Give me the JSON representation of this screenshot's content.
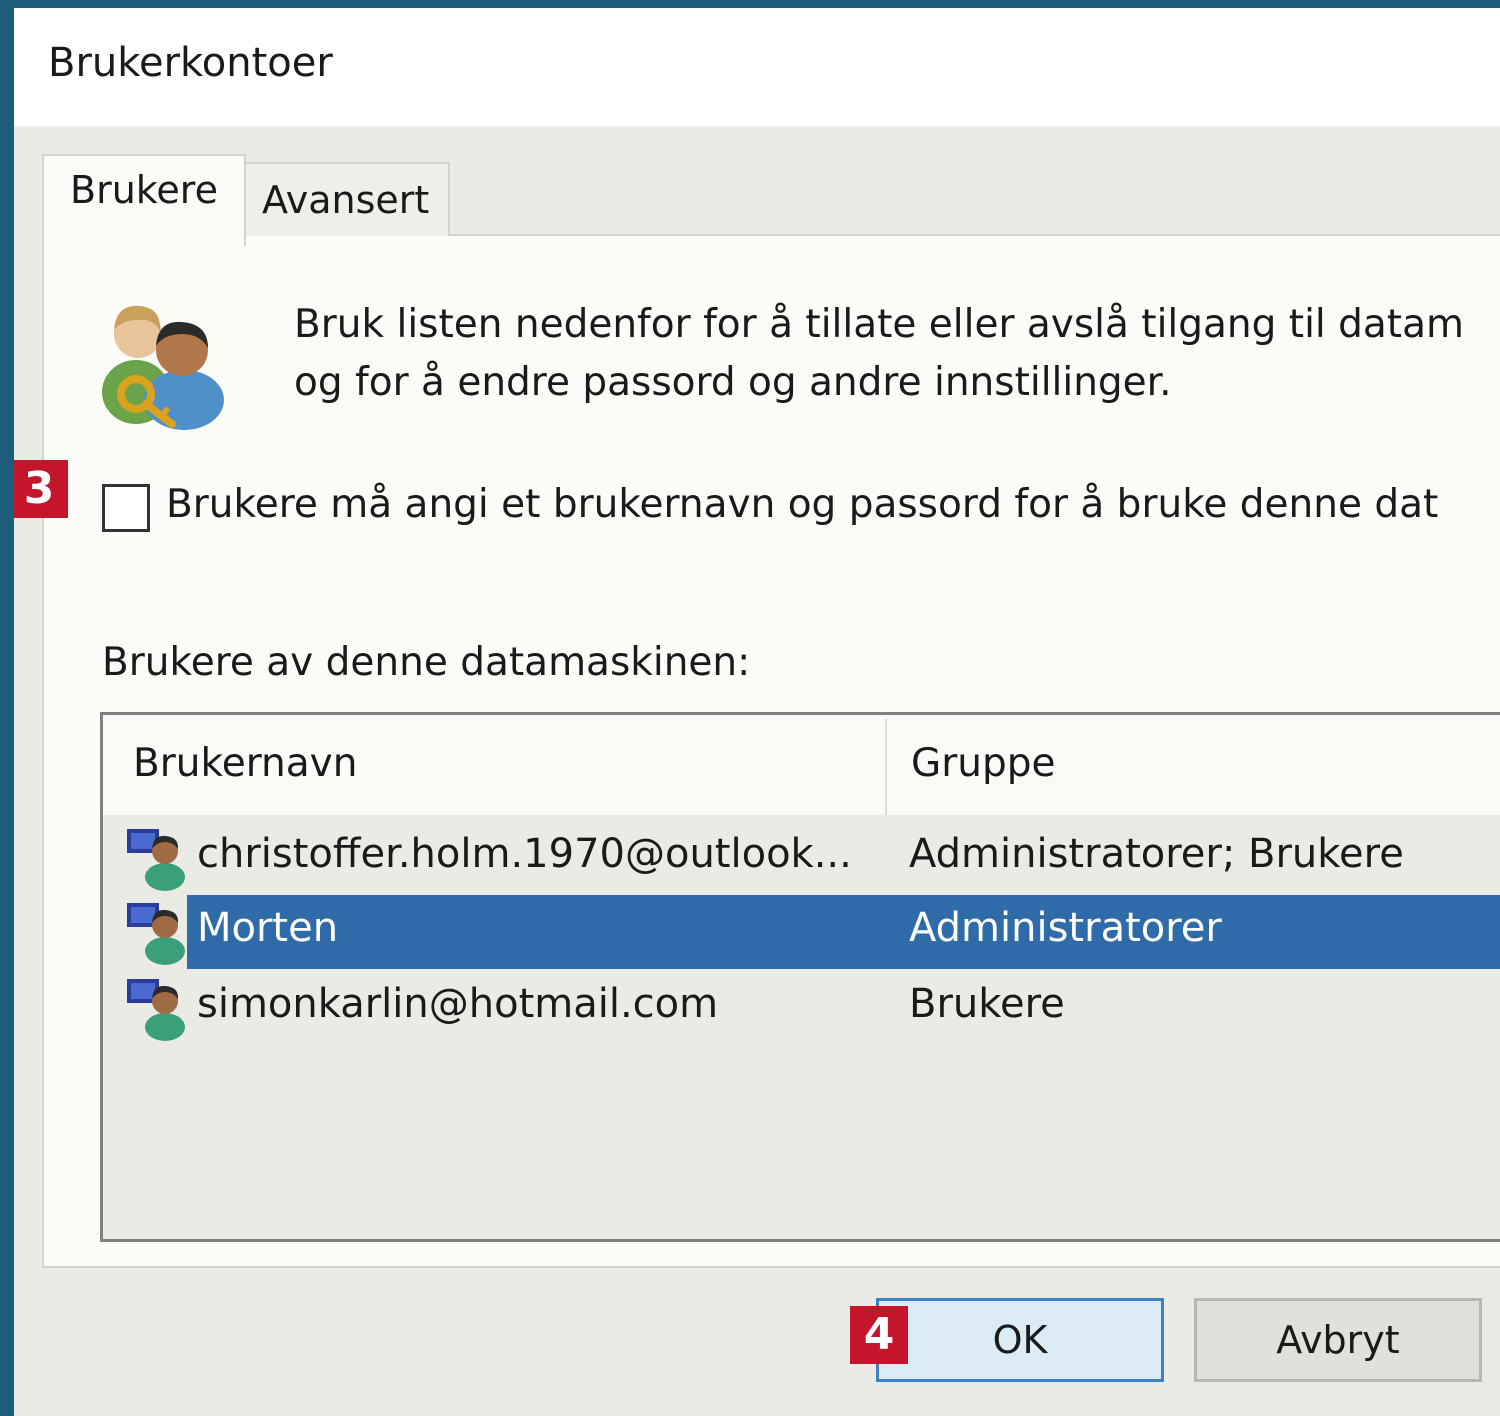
{
  "window": {
    "title": "Brukerkontoer"
  },
  "tabs": [
    {
      "label": "Brukere",
      "active": true
    },
    {
      "label": "Avansert",
      "active": false
    }
  ],
  "description": {
    "line1": "Bruk listen nedenfor for å tillate eller avslå tilgang til datam",
    "line2": "og for å endre passord og andre innstillinger.",
    "icon": "users-key-icon"
  },
  "require_login": {
    "label": "Brukere må angi et brukernavn og passord for å bruke denne dat",
    "checked": false
  },
  "users_section": {
    "label": "Brukere av denne datamaskinen:"
  },
  "user_table": {
    "columns": [
      "Brukernavn",
      "Gruppe"
    ],
    "rows": [
      {
        "username": "christoffer.holm.1970@outlook...",
        "group": "Administratorer; Brukere",
        "selected": false
      },
      {
        "username": "Morten",
        "group": "Administratorer",
        "selected": true
      },
      {
        "username": "simonkarlin@hotmail.com",
        "group": "Brukere",
        "selected": false
      }
    ]
  },
  "buttons": {
    "ok": "OK",
    "cancel": "Avbryt"
  },
  "annotations": {
    "step_checkbox": "3",
    "step_ok": "4"
  },
  "colors": {
    "selection": "#2f6ba8",
    "badge": "#c4152a",
    "window_border": "#1d5d7a",
    "ok_border": "#3b83c6"
  }
}
